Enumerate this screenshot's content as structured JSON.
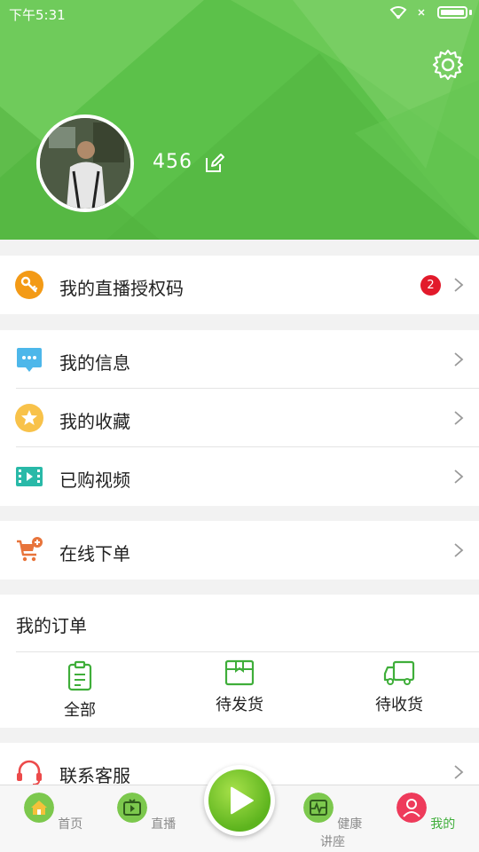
{
  "status": {
    "time": "下午5:31"
  },
  "profile": {
    "username": "456"
  },
  "menu": {
    "auth_code": {
      "label": "我的直播授权码",
      "badge": "2"
    },
    "messages": {
      "label": "我的信息"
    },
    "favorites": {
      "label": "我的收藏"
    },
    "purchased_videos": {
      "label": "已购视频"
    },
    "online_order": {
      "label": "在线下单"
    },
    "support": {
      "label": "联系客服"
    }
  },
  "orders": {
    "title": "我的订单",
    "tabs": [
      {
        "label": "全部"
      },
      {
        "label": "待发货"
      },
      {
        "label": "待收货"
      }
    ]
  },
  "nav": {
    "items": [
      {
        "label": "首页"
      },
      {
        "label": "直播"
      },
      {
        "label": "健康讲座"
      },
      {
        "label": "我的"
      }
    ],
    "active_color": "#3fae3a"
  },
  "colors": {
    "accent": "#5cc14a",
    "badge": "#e21a2b"
  },
  "icons": [
    "gear-icon",
    "edit-icon",
    "key-icon",
    "chat-icon",
    "star-icon",
    "video-icon",
    "cart-icon",
    "headset-icon",
    "clipboard-icon",
    "box-icon",
    "truck-icon",
    "home-icon",
    "tv-icon",
    "play-icon",
    "heartbeat-icon",
    "user-icon",
    "chevron-right-icon"
  ]
}
